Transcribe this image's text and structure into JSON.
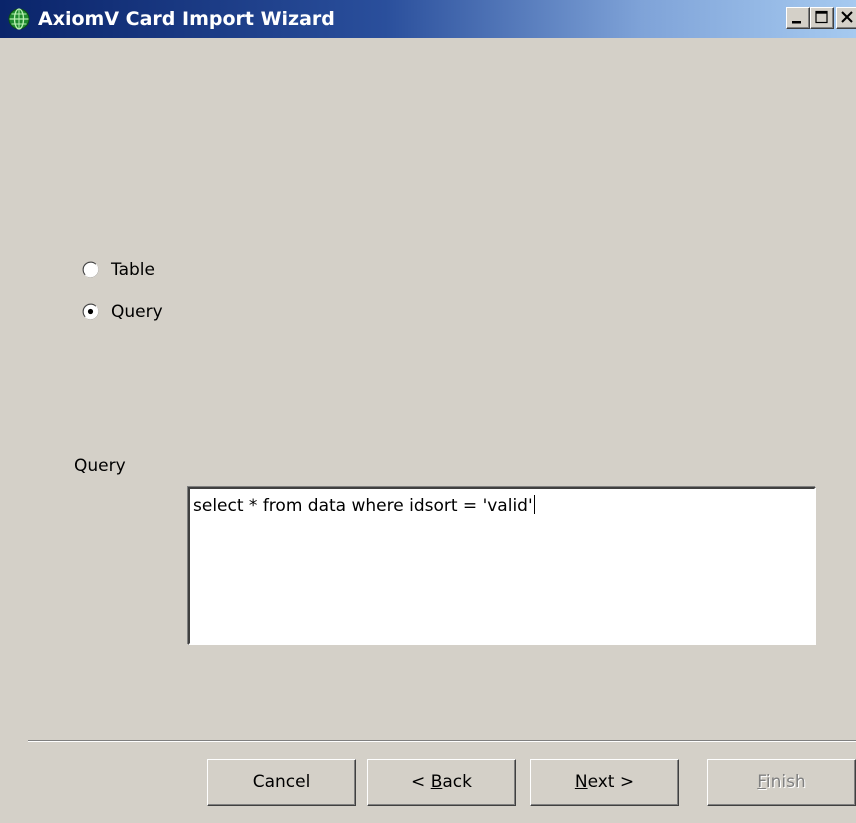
{
  "window": {
    "title": "AxiomV  Card Import Wizard",
    "controls": {
      "minimize": "minimize",
      "maximize": "maximize",
      "close": "close"
    }
  },
  "source_type": {
    "options": [
      {
        "label": "Table",
        "selected": false
      },
      {
        "label": "Query",
        "selected": true
      }
    ]
  },
  "query": {
    "label": "Query",
    "value": "select * from data where idsort = 'valid'"
  },
  "buttons": {
    "cancel": {
      "label": "Cancel",
      "enabled": true
    },
    "back": {
      "prefix": "< ",
      "mnemonic": "B",
      "rest": "ack",
      "enabled": true
    },
    "next": {
      "mnemonic": "N",
      "rest": "ext >",
      "enabled": true
    },
    "finish": {
      "mnemonic": "F",
      "rest": "inish",
      "enabled": false
    }
  },
  "colors": {
    "dialog_background": "#d4d0c8",
    "titlebar_start": "#0a246a",
    "titlebar_end": "#a6caf0",
    "disabled_text": "#808080"
  },
  "icons": {
    "app": "globe-icon",
    "minimize": "minimize-icon",
    "maximize": "maximize-icon",
    "close": "close-icon"
  }
}
